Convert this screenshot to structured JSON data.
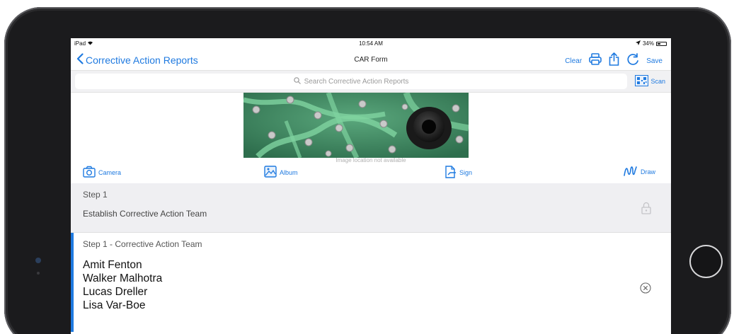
{
  "status_bar": {
    "device": "iPad",
    "time": "10:54 AM",
    "battery": "34%",
    "battery_level": 0.34
  },
  "nav": {
    "back_label": "Corrective Action Reports",
    "title": "CAR Form",
    "clear_label": "Clear",
    "save_label": "Save"
  },
  "search": {
    "placeholder": "Search Corrective Action Reports",
    "scan_label": "Scan"
  },
  "photo": {
    "caption": "Image location not available"
  },
  "attachments": {
    "camera_label": "Camera",
    "album_label": "Album",
    "sign_label": "Sign",
    "draw_label": "Draw"
  },
  "step": {
    "label": "Step 1",
    "title": "Establish Corrective Action Team"
  },
  "team_section": {
    "label": "Step 1 - Corrective Action Team",
    "members": [
      "Amit Fenton",
      "Walker Malhotra",
      "Lucas Dreller",
      "Lisa Var-Boe"
    ]
  },
  "icons": {
    "back": "chevron-left-icon",
    "print": "printer-icon",
    "share": "share-icon",
    "refresh": "refresh-icon",
    "search": "magnifier-icon",
    "scan": "qr-code-icon",
    "camera": "camera-icon",
    "album": "photo-album-icon",
    "sign": "signature-document-icon",
    "draw": "squiggle-draw-icon",
    "lock": "lock-icon",
    "clear": "circle-x-icon",
    "wifi": "wifi-icon",
    "location": "location-arrow-icon",
    "battery": "battery-icon"
  },
  "colors": {
    "accent": "#1f7ae0",
    "step_header_bg": "#efeff2",
    "frame": "#1b1b1d"
  }
}
